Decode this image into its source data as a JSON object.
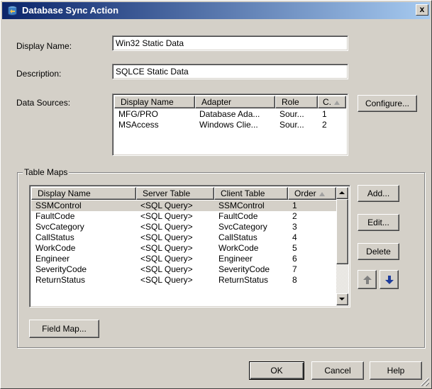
{
  "window": {
    "title": "Database Sync Action",
    "close_label": "x"
  },
  "form": {
    "display_name_label": "Display Name:",
    "display_name_value": "Win32 Static Data",
    "description_label": "Description:",
    "description_value": "SQLCE Static Data",
    "data_sources_label": "Data Sources:",
    "configure_label": "Configure..."
  },
  "data_sources": {
    "columns": [
      "Display Name",
      "Adapter",
      "Role",
      "C."
    ],
    "rows": [
      [
        "MFG/PRO",
        "Database Ada...",
        "Sour...",
        "1"
      ],
      [
        "MSAccess",
        "Windows Clie...",
        "Sour...",
        "2"
      ]
    ]
  },
  "table_maps": {
    "legend": "Table Maps",
    "columns": [
      "Display Name",
      "Server Table",
      "Client Table",
      "Order"
    ],
    "rows": [
      [
        "SSMControl",
        "<SQL Query>",
        "SSMControl",
        "1"
      ],
      [
        "FaultCode",
        "<SQL Query>",
        "FaultCode",
        "2"
      ],
      [
        "SvcCategory",
        "<SQL Query>",
        "SvcCategory",
        "3"
      ],
      [
        "CallStatus",
        "<SQL Query>",
        "CallStatus",
        "4"
      ],
      [
        "WorkCode",
        "<SQL Query>",
        "WorkCode",
        "5"
      ],
      [
        "Engineer",
        "<SQL Query>",
        "Engineer",
        "6"
      ],
      [
        "SeverityCode",
        "<SQL Query>",
        "SeverityCode",
        "7"
      ],
      [
        "ReturnStatus",
        "<SQL Query>",
        "ReturnStatus",
        "8"
      ]
    ],
    "selected_row": "SSMControl",
    "add_label": "Add...",
    "edit_label": "Edit...",
    "delete_label": "Delete",
    "field_map_label": "Field Map..."
  },
  "footer": {
    "ok_label": "OK",
    "cancel_label": "Cancel",
    "help_label": "Help"
  },
  "icons": {
    "title_icon": "database-sync-icon",
    "move_up": "arrow-up-icon",
    "move_down": "arrow-down-icon"
  },
  "colors": {
    "titlebar_start": "#0a246a",
    "titlebar_end": "#a6caf0",
    "arrow_blue": "#1e3c9c"
  }
}
